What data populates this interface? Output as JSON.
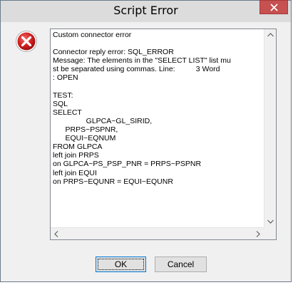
{
  "window": {
    "title": "Script Error",
    "close_icon": "close-icon"
  },
  "icon": {
    "name": "error-icon",
    "color": "#d32020"
  },
  "message_lines": [
    "Custom connector error",
    "",
    "Connector reply error: SQL_ERROR",
    "Message: The elements in the \"SELECT LIST\" list mu",
    "st be separated using commas. Line:          3 Word",
    ": OPEN",
    "",
    "TEST:",
    "SQL",
    "SELECT",
    "                GLPCA~GL_SIRID,",
    "      PRPS~PSPNR,",
    "      EQUI~EQNUM",
    "FROM GLPCA",
    "left join PRPS",
    "on GLPCA~PS_PSP_PNR = PRPS~PSPNR",
    "left join EQUI",
    "on PRPS~EQUNR = EQUI~EQUNR"
  ],
  "buttons": {
    "ok": "OK",
    "cancel": "Cancel"
  },
  "colors": {
    "dialog_bg": "#f0f0f0",
    "close_button": "#c75050",
    "default_button_border": "#0078d7"
  }
}
